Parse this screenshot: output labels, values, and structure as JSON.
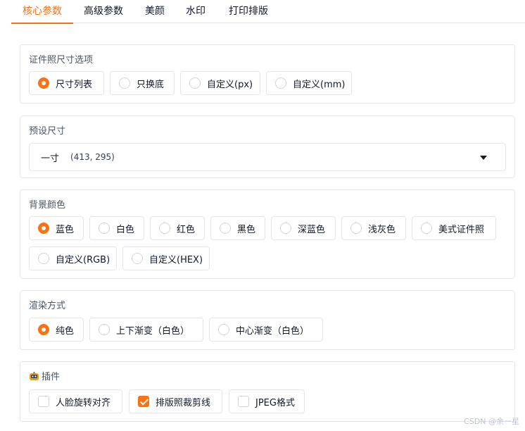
{
  "tabs": [
    {
      "label": "核心参数",
      "active": true
    },
    {
      "label": "高级参数",
      "active": false
    },
    {
      "label": "美颜",
      "active": false
    },
    {
      "label": "水印",
      "active": false
    },
    {
      "label": "打印排版",
      "active": false
    }
  ],
  "size_options": {
    "title": "证件照尺寸选项",
    "options": [
      "尺寸列表",
      "只换底",
      "自定义(px)",
      "自定义(mm)"
    ],
    "selected": "尺寸列表"
  },
  "preset_size": {
    "title": "预设尺寸",
    "value": "一寸",
    "dimensions": "(413, 295)"
  },
  "background_color": {
    "title": "背景颜色",
    "options": [
      "蓝色",
      "白色",
      "红色",
      "黑色",
      "深蓝色",
      "浅灰色",
      "美式证件照",
      "自定义(RGB)",
      "自定义(HEX)"
    ],
    "selected": "蓝色"
  },
  "render_mode": {
    "title": "渲染方式",
    "options": [
      "纯色",
      "上下渐变（白色）",
      "中心渐变（白色）"
    ],
    "selected": "纯色"
  },
  "plugins": {
    "title": "插件",
    "icon": "robot-icon",
    "options": [
      {
        "label": "人脸旋转对齐",
        "checked": false
      },
      {
        "label": "排版照裁剪线",
        "checked": true
      },
      {
        "label": "JPEG格式",
        "checked": false
      }
    ]
  },
  "watermark": "CSDN @余一星",
  "colors": {
    "accent": "#f97316",
    "border": "#e5e7eb"
  }
}
